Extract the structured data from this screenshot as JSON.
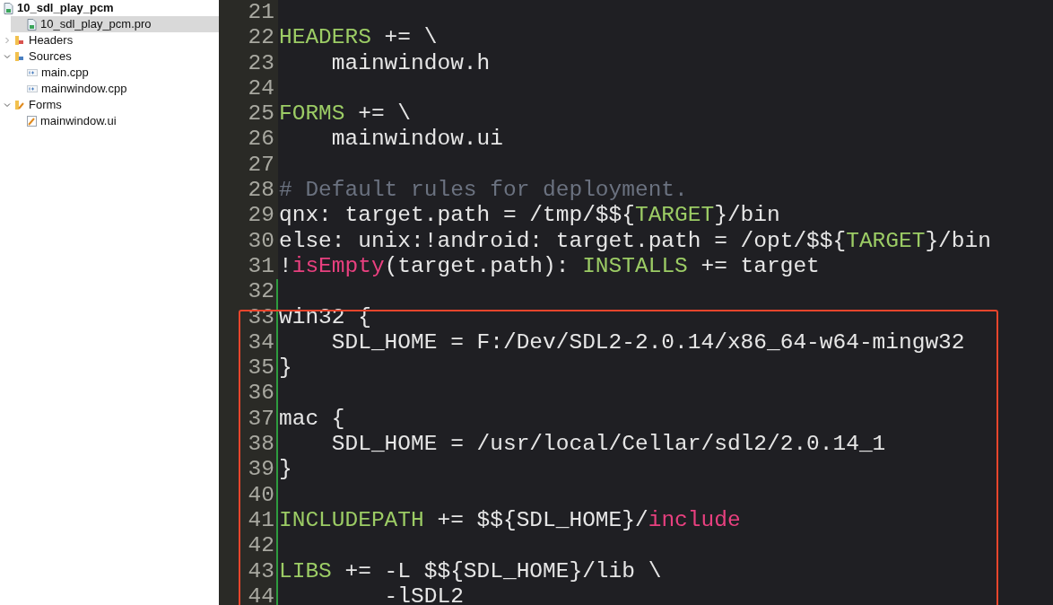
{
  "project_tree": [
    {
      "label": "10_sdl_play_pcm",
      "kind": "project",
      "selected": false,
      "children": [
        {
          "label": "10_sdl_play_pcm.pro",
          "kind": "pro",
          "selected": true
        },
        {
          "label": "Headers",
          "kind": "headers",
          "expanded": false,
          "selected": false
        },
        {
          "label": "Sources",
          "kind": "sources",
          "expanded": true,
          "selected": false,
          "children": [
            {
              "label": "main.cpp",
              "kind": "cpp",
              "selected": false
            },
            {
              "label": "mainwindow.cpp",
              "kind": "cpp",
              "selected": false
            }
          ]
        },
        {
          "label": "Forms",
          "kind": "forms",
          "expanded": true,
          "selected": false,
          "children": [
            {
              "label": "mainwindow.ui",
              "kind": "ui",
              "selected": false
            }
          ]
        }
      ]
    }
  ],
  "editor": {
    "lines": [
      {
        "number": "21",
        "modified": false
      },
      {
        "number": "22",
        "modified": false,
        "tokens": [
          {
            "kind": "keyword",
            "text": "HEADERS"
          },
          {
            "kind": "plain",
            "text": " += \\"
          }
        ]
      },
      {
        "number": "23",
        "modified": false,
        "tokens": [
          {
            "kind": "plain",
            "text": "    mainwindow.h"
          }
        ]
      },
      {
        "number": "24",
        "modified": false
      },
      {
        "number": "25",
        "modified": false,
        "tokens": [
          {
            "kind": "keyword",
            "text": "FORMS"
          },
          {
            "kind": "plain",
            "text": " += \\"
          }
        ]
      },
      {
        "number": "26",
        "modified": false,
        "tokens": [
          {
            "kind": "plain",
            "text": "    mainwindow.ui"
          }
        ]
      },
      {
        "number": "27",
        "modified": false
      },
      {
        "number": "28",
        "modified": false,
        "tokens": [
          {
            "kind": "comment",
            "text": "# Default rules for deployment."
          }
        ]
      },
      {
        "number": "29",
        "modified": false,
        "tokens": [
          {
            "kind": "plain",
            "text": "qnx: target.path = /tmp/$${"
          },
          {
            "kind": "keyword",
            "text": "TARGET"
          },
          {
            "kind": "plain",
            "text": "}/bin"
          }
        ]
      },
      {
        "number": "30",
        "modified": false,
        "tokens": [
          {
            "kind": "plain",
            "text": "else: unix:!android: target.path = /opt/$${"
          },
          {
            "kind": "keyword",
            "text": "TARGET"
          },
          {
            "kind": "plain",
            "text": "}/bin"
          }
        ]
      },
      {
        "number": "31",
        "modified": false,
        "tokens": [
          {
            "kind": "plain",
            "text": "!"
          },
          {
            "kind": "function",
            "text": "isEmpty"
          },
          {
            "kind": "plain",
            "text": "(target.path): "
          },
          {
            "kind": "keyword",
            "text": "INSTALLS"
          },
          {
            "kind": "plain",
            "text": " += target"
          }
        ]
      },
      {
        "number": "32",
        "modified": true
      },
      {
        "number": "33",
        "modified": true,
        "tokens": [
          {
            "kind": "plain",
            "text": "win32 {"
          }
        ]
      },
      {
        "number": "34",
        "modified": true,
        "tokens": [
          {
            "kind": "plain",
            "text": "    SDL_HOME = F:/Dev/SDL2-2.0.14/x86_64-w64-mingw32"
          }
        ]
      },
      {
        "number": "35",
        "modified": true,
        "tokens": [
          {
            "kind": "plain",
            "text": "}"
          }
        ]
      },
      {
        "number": "36",
        "modified": true
      },
      {
        "number": "37",
        "modified": true,
        "tokens": [
          {
            "kind": "plain",
            "text": "mac {"
          }
        ]
      },
      {
        "number": "38",
        "modified": true,
        "tokens": [
          {
            "kind": "plain",
            "text": "    SDL_HOME = /usr/local/Cellar/sdl2/2.0.14_1"
          }
        ]
      },
      {
        "number": "39",
        "modified": true,
        "tokens": [
          {
            "kind": "plain",
            "text": "}"
          }
        ]
      },
      {
        "number": "40",
        "modified": true
      },
      {
        "number": "41",
        "modified": true,
        "tokens": [
          {
            "kind": "keyword",
            "text": "INCLUDEPATH"
          },
          {
            "kind": "plain",
            "text": " += $${SDL_HOME}/"
          },
          {
            "kind": "function",
            "text": "include"
          }
        ]
      },
      {
        "number": "42",
        "modified": true
      },
      {
        "number": "43",
        "modified": true,
        "tokens": [
          {
            "kind": "keyword",
            "text": "LIBS"
          },
          {
            "kind": "plain",
            "text": " += -L $${SDL_HOME}/lib \\"
          }
        ]
      },
      {
        "number": "44",
        "modified": true,
        "tokens": [
          {
            "kind": "plain",
            "text": "        -lSDL2"
          }
        ]
      }
    ]
  }
}
